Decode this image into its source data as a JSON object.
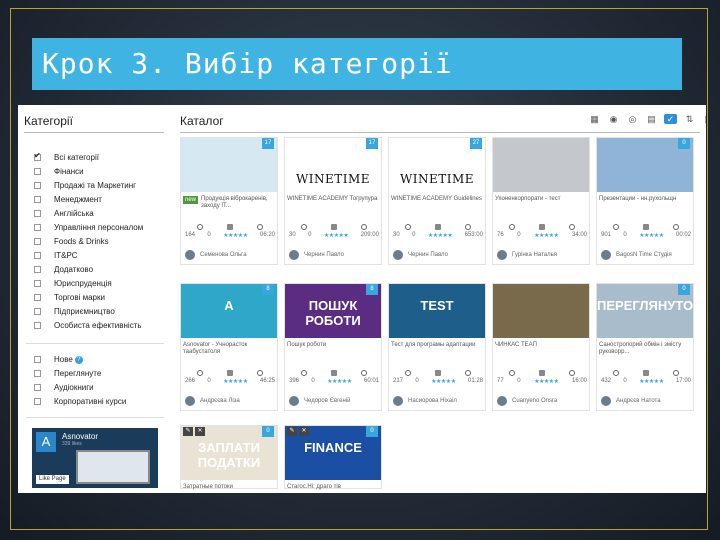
{
  "slide": {
    "title": "Крок 3. Вибір категорії"
  },
  "sidebar": {
    "title": "Категорії",
    "categories": [
      {
        "label": "Всі категорії",
        "checked": true
      },
      {
        "label": "Фінанси",
        "checked": false
      },
      {
        "label": "Продажі та Маркетинг",
        "checked": false
      },
      {
        "label": "Менеджмент",
        "checked": false
      },
      {
        "label": "Англійська",
        "checked": false
      },
      {
        "label": "Управління персоналом",
        "checked": false
      },
      {
        "label": "Foods & Drinks",
        "checked": false
      },
      {
        "label": "IT&PC",
        "checked": false
      },
      {
        "label": "Додатково",
        "checked": false
      },
      {
        "label": "Юриспруденція",
        "checked": false
      },
      {
        "label": "Торгові марки",
        "checked": false
      },
      {
        "label": "Підприємництво",
        "checked": false
      },
      {
        "label": "Особиста ефективність",
        "checked": false
      }
    ],
    "extra": [
      {
        "label": "Нове",
        "checked": false
      },
      {
        "label": "Переглянуте",
        "checked": false
      },
      {
        "label": "Аудіокниги",
        "checked": false
      },
      {
        "label": "Корпоративні курси",
        "checked": false
      }
    ],
    "ad": {
      "name": "Asnovator",
      "sub": "339 likes",
      "like_label": "Like Page",
      "logo": "A"
    }
  },
  "main": {
    "title": "Каталог",
    "toolbar": [
      "calendar-icon",
      "eye-icon",
      "eye-off-icon",
      "clipboard-icon",
      "check-icon",
      "sort-icon",
      "grid-icon"
    ],
    "cards": [
      {
        "badge": "17",
        "tag": "new",
        "title": "Продукція віброкаренів, заходу IT...",
        "views": "164",
        "comments": "0",
        "time": "06:20",
        "author": "Семенова Ольга",
        "thumb_color": "#d6e8f2",
        "thumb_text": ""
      },
      {
        "badge": "17",
        "tag": "",
        "title": "WINETIME ACADEMY Тогрупура",
        "views": "30",
        "comments": "0",
        "time": "209:00",
        "author": "Чернин Павло",
        "thumb_color": "#ffffff",
        "thumb_text": "WINETIME"
      },
      {
        "badge": "27",
        "tag": "",
        "title": "WINETIME ACADEMY Guidelines",
        "views": "30",
        "comments": "0",
        "time": "653:00",
        "author": "Чернин Павло",
        "thumb_color": "#ffffff",
        "thumb_text": "WINETIME"
      },
      {
        "badge": "",
        "tag": "",
        "title": "Ухоненкорпорати - тест",
        "views": "76",
        "comments": "0",
        "time": "34:00",
        "author": "Гурінка Наталья",
        "thumb_color": "#c4c8cc",
        "thumb_text": ""
      },
      {
        "badge": "0",
        "tag": "",
        "title": "Презентации - нн.рухольщн",
        "views": "901",
        "comments": "0",
        "time": "00:02",
        "author": "BagosN Time Студія",
        "thumb_color": "#8fb4d8",
        "thumb_text": ""
      },
      {
        "badge": "8",
        "tag": "",
        "title": "Asnovator - Учнорасток таабустатоля",
        "views": "266",
        "comments": "0",
        "time": "46:25",
        "author": "Андрєєва Ліза",
        "thumb_color": "#2ea7c9",
        "thumb_text": "A"
      },
      {
        "badge": "8",
        "tag": "",
        "title": "Пошук роботи",
        "views": "396",
        "comments": "0",
        "time": "60:01",
        "author": "Чедоров Євгеній",
        "thumb_color": "#5a2d82",
        "thumb_text": "ПОШУК РОБОТИ"
      },
      {
        "badge": "",
        "tag": "",
        "title": "Тест для програмы адаптации",
        "views": "217",
        "comments": "0",
        "time": "01:28",
        "author": "Насиорова Ніхаіл",
        "thumb_color": "#1d5f8a",
        "thumb_text": "TEST"
      },
      {
        "badge": "",
        "tag": "",
        "title": "ЧИНКАС ТЕАП",
        "views": "77",
        "comments": "0",
        "time": "16:00",
        "author": "Cuanyeno Onsra",
        "thumb_color": "#7a6a4c",
        "thumb_text": ""
      },
      {
        "badge": "0",
        "tag": "",
        "title": "Саностропорий обмін і змісту руковорр...",
        "views": "432",
        "comments": "0",
        "time": "17:00",
        "author": "Андрєєв Натота",
        "thumb_color": "#a8bccb",
        "thumb_text": "ПЕРЕГЛЯНУТО"
      },
      {
        "badge": "0",
        "tag": "",
        "title": "Затратные потоки",
        "views": "",
        "comments": "",
        "time": "",
        "author": "",
        "thumb_color": "#e9e3d6",
        "thumb_text": "ЗАПЛАТИ ПОДАТКИ"
      },
      {
        "badge": "0",
        "tag": "",
        "title": "Стагос.Ні: драго тів",
        "views": "",
        "comments": "",
        "time": "",
        "author": "",
        "thumb_color": "#1a4fa3",
        "thumb_text": "FINANCE"
      }
    ]
  },
  "icons": {
    "stars": "★★★★★"
  }
}
